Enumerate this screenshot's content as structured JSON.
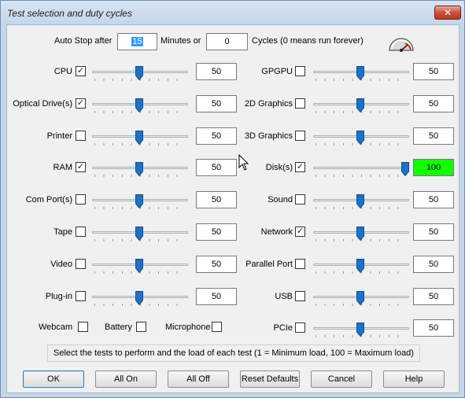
{
  "window": {
    "title": "Test selection and duty cycles",
    "close_label": "✕"
  },
  "autostop": {
    "prefix": "Auto Stop after",
    "minutes_value": "15",
    "minutes_label": "Minutes or",
    "cycles_value": "0",
    "cycles_label": "Cycles (0 means run forever)"
  },
  "tests_left": [
    {
      "label": "CPU",
      "checked": true,
      "value": "50",
      "level": 50
    },
    {
      "label": "Optical Drive(s)",
      "checked": true,
      "value": "50",
      "level": 50
    },
    {
      "label": "Printer",
      "checked": false,
      "value": "50",
      "level": 50
    },
    {
      "label": "RAM",
      "checked": true,
      "value": "50",
      "level": 50
    },
    {
      "label": "Com Port(s)",
      "checked": false,
      "value": "50",
      "level": 50
    },
    {
      "label": "Tape",
      "checked": false,
      "value": "50",
      "level": 50
    },
    {
      "label": "Video",
      "checked": false,
      "value": "50",
      "level": 50
    },
    {
      "label": "Plug-in",
      "checked": false,
      "value": "50",
      "level": 50
    }
  ],
  "tests_right": [
    {
      "label": "GPGPU",
      "checked": false,
      "value": "50",
      "level": 50
    },
    {
      "label": "2D Graphics",
      "checked": false,
      "value": "50",
      "level": 50
    },
    {
      "label": "3D Graphics",
      "checked": false,
      "value": "50",
      "level": 50
    },
    {
      "label": "Disk(s)",
      "checked": true,
      "value": "100",
      "level": 100
    },
    {
      "label": "Sound",
      "checked": false,
      "value": "50",
      "level": 50
    },
    {
      "label": "Network",
      "checked": true,
      "value": "50",
      "level": 50
    },
    {
      "label": "Parallel Port",
      "checked": false,
      "value": "50",
      "level": 50
    },
    {
      "label": "USB",
      "checked": false,
      "value": "50",
      "level": 50
    },
    {
      "label": "PCIe",
      "checked": false,
      "value": "50",
      "level": 50
    }
  ],
  "extras": [
    {
      "label": "Webcam",
      "checked": false
    },
    {
      "label": "Battery",
      "checked": false
    },
    {
      "label": "Microphone",
      "checked": false
    }
  ],
  "hint": "Select the tests to perform and the load of each test (1 = Minimum load, 100 = Maximum load)",
  "buttons": {
    "ok": "OK",
    "all_on": "All On",
    "all_off": "All Off",
    "reset": "Reset Defaults",
    "cancel": "Cancel",
    "help": "Help"
  },
  "colors": {
    "thumb": "#1a73c9",
    "highlight_box": "#11ff00",
    "selection": "#3399ff"
  }
}
